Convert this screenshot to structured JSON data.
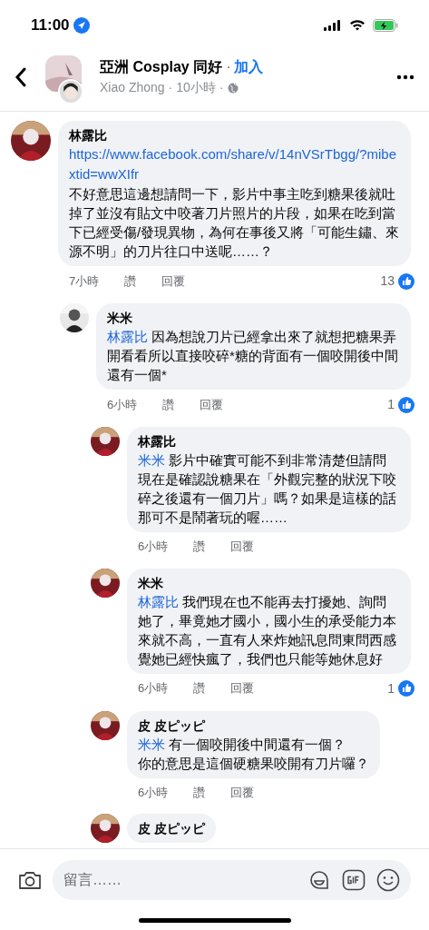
{
  "status_bar": {
    "time": "11:00"
  },
  "header": {
    "group": "亞洲 Cosplay 同好",
    "separators": [
      "·",
      "·",
      "·"
    ],
    "join": "加入",
    "author": "Xiao Zhong",
    "time": "10小時"
  },
  "comments": [
    {
      "author": "林露比",
      "link": "https://www.facebook.com/share/v/14nVSrTbgg/?mibextid=wwXIfr",
      "text": "不好意思這邊想請問一下，影片中事主吃到糖果後就吐掉了並沒有貼文中咬著刀片照片的片段，如果在吃到當下已經受傷/發現異物，為何在事後又將「可能生鏽、來源不明」的刀片往口中送呢……？",
      "time": "7小時",
      "like": "讚",
      "reply": "回覆",
      "likes": "13",
      "children": [
        {
          "author": "米米",
          "mention": "林露比",
          "text": "因為想說刀片已經拿出來了就想把糖果弄開看看所以直接咬碎*糖的背面有一個咬開後中間還有一個*",
          "time": "6小時",
          "like": "讚",
          "reply": "回覆",
          "likes": "1",
          "children": [
            {
              "author": "林露比",
              "mention": "米米",
              "text": "影片中確實可能不到非常清楚但請問現在是確認說糖果在「外觀完整的狀況下咬碎之後還有一個刀片」嗎？如果是這樣的話那可不是鬧著玩的喔……",
              "time": "6小時",
              "like": "讚",
              "reply": "回覆"
            },
            {
              "author": "米米",
              "mention": "林露比",
              "text": "我們現在也不能再去打擾她、詢問她了，畢竟她才國小，國小生的承受能力本來就不高，一直有人來炸她訊息問東問西感覺她已經快瘋了，我們也只能等她休息好",
              "time": "6小時",
              "like": "讚",
              "reply": "回覆",
              "likes": "1"
            },
            {
              "author": "皮 皮ピッピ",
              "mention": "米米",
              "text": "有一個咬開後中間還有一個？",
              "text_2": "你的意思是這個硬糖果咬開有刀片囉？",
              "time": "6小時",
              "like": "讚",
              "reply": "回覆"
            },
            {
              "author": "皮 皮ピッピ"
            }
          ]
        }
      ]
    }
  ],
  "composer": {
    "placeholder": "留言……"
  }
}
